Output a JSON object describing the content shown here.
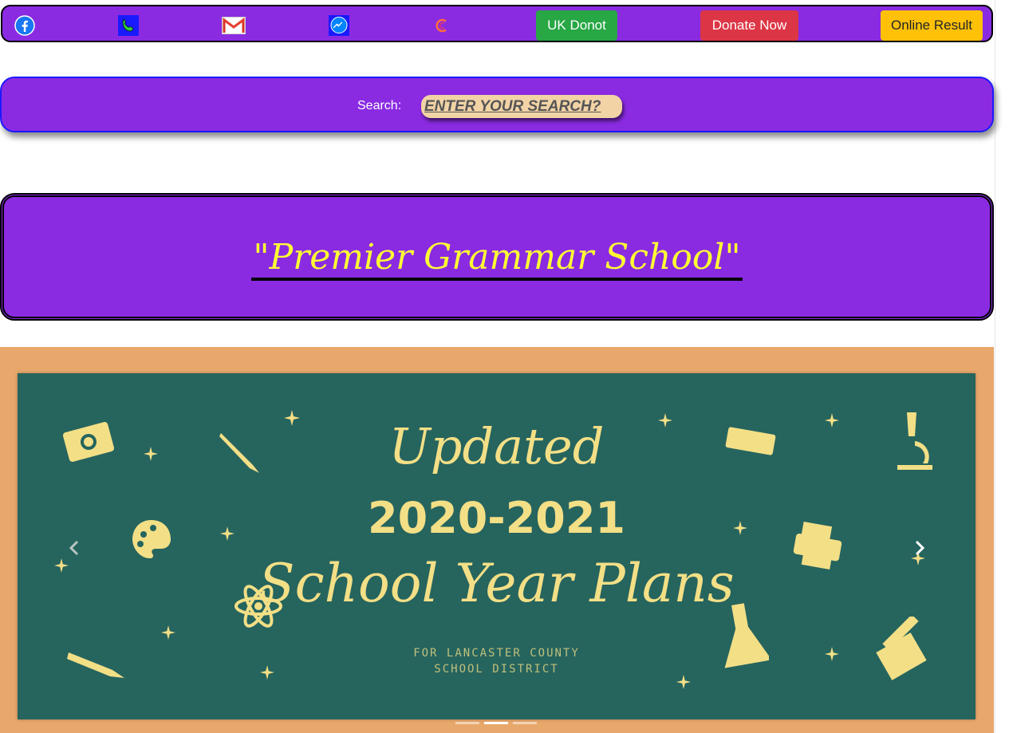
{
  "topbar": {
    "icons": [
      "facebook-icon",
      "phone-icon",
      "gmail-icon",
      "messenger-icon",
      "spinner-icon"
    ],
    "buttons": {
      "uk_donot": "UK Donot",
      "donate_now": "Donate Now",
      "online_result": "Online Result"
    },
    "colors": {
      "bar": "#8a2be2",
      "green": "#28a745",
      "red": "#dc3545",
      "yellow": "#ffc107"
    }
  },
  "search": {
    "label": "Search:",
    "placeholder": "ENTER YOUR SEARCH?"
  },
  "header": {
    "title": "\"Premier Grammar School\""
  },
  "carousel": {
    "slide": {
      "line1": "Updated",
      "line2": "2020-2021",
      "line3": "School Year Plans",
      "sub1": "FOR LANCASTER COUNTY",
      "sub2": "SCHOOL DISTRICT"
    },
    "prev_icon": "chevron-left-icon",
    "next_icon": "chevron-right-icon",
    "indicator_count": 3,
    "active_indicator": 2
  }
}
